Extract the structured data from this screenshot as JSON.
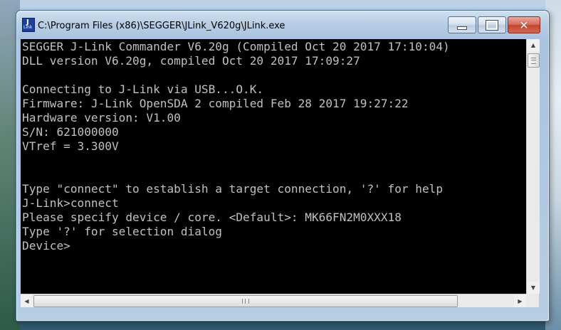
{
  "window": {
    "title": "C:\\Program Files (x86)\\SEGGER\\JLink_V620g\\JLink.exe",
    "icon": "jlink-app-icon",
    "controls": {
      "minimize_icon": "minimize-icon",
      "maximize_icon": "maximize-icon",
      "close_icon": "close-icon",
      "close_glyph": "✕"
    }
  },
  "console": {
    "lines": [
      "SEGGER J-Link Commander V6.20g (Compiled Oct 20 2017 17:10:04)",
      "DLL version V6.20g, compiled Oct 20 2017 17:09:27",
      "",
      "Connecting to J-Link via USB...O.K.",
      "Firmware: J-Link OpenSDA 2 compiled Feb 28 2017 19:27:22",
      "Hardware version: V1.00",
      "S/N: 621000000",
      "VTref = 3.300V",
      "",
      "",
      "Type \"connect\" to establish a target connection, '?' for help",
      "J-Link>connect",
      "Please specify device / core. <Default>: MK66FN2M0XXX18",
      "Type '?' for selection dialog",
      "Device>"
    ]
  },
  "scrollbars": {
    "up_arrow": "▲",
    "down_arrow": "▼",
    "left_arrow": "◀",
    "right_arrow": "▶"
  },
  "colors": {
    "console_bg": "#000000",
    "console_fg": "#c0c0c0",
    "close_button": "#c6462f"
  }
}
